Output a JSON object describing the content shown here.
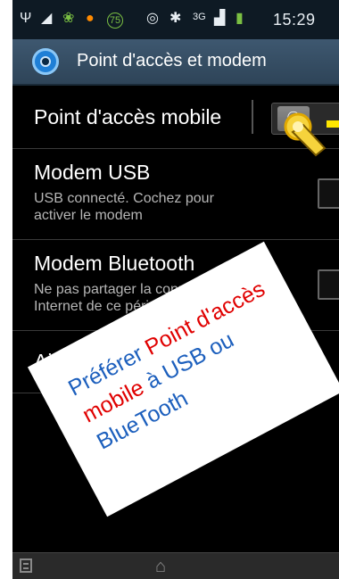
{
  "status_bar": {
    "icons": [
      "usb-icon",
      "signal-bars-icon",
      "leaf-icon",
      "alarm-icon",
      "battery-75-icon",
      "eye-icon",
      "bluetooth-icon",
      "3g-icon",
      "signal-icon",
      "charging-battery-icon"
    ],
    "badge_75": "75",
    "network": "3G",
    "time": "15:29"
  },
  "action_bar": {
    "title": "Point d'accès et modem"
  },
  "items": [
    {
      "title": "Point d'accès mobile"
    },
    {
      "title": "Modem USB",
      "subtitle_line1": "USB connecté. Cochez pour",
      "subtitle_line2": "activer le modem"
    },
    {
      "title": "Modem Bluetooth",
      "subtitle_line1": "Ne pas partager la connexion",
      "subtitle_line2": "Internet de ce périphériq..."
    },
    {
      "title": "Aide"
    }
  ],
  "note": {
    "line1_blue": "Préférer ",
    "line1_red": "Point d'accès",
    "line2_red": "mobile",
    "line2_blue": " à USB ou",
    "line3_blue": "BlueTooth"
  },
  "colors": {
    "action_bar": "#2e4458",
    "note_blue": "#1c5fbd",
    "note_red": "#e00000",
    "arrow": "#ffe600"
  }
}
